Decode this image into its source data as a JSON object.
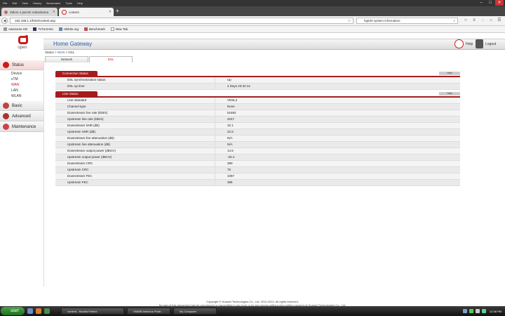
{
  "browser": {
    "menu": [
      "File",
      "Edit",
      "View",
      "History",
      "Bookmarks",
      "Tools",
      "Help"
    ],
    "tabs": [
      {
        "label": "Zakon o javnim nabavkama",
        "active": false
      },
      {
        "label": "content",
        "active": true
      }
    ],
    "url": "192.168.1.1/html/content.asp",
    "search_text": "hg630 system information",
    "bookmarks": [
      "Awesome HD",
      "TvTorrents",
      "HDbits.org",
      "Benchmark",
      "New Tab"
    ]
  },
  "app": {
    "logo_text": "open",
    "title": "Home Gateway",
    "help_label": "Help",
    "logout_label": "Logout",
    "breadcrumb": {
      "a": "Status",
      "sep": " > ",
      "b": "WAN",
      "c": "DSL"
    },
    "subtabs": [
      {
        "label": "Network",
        "active": false
      },
      {
        "label": "DSL",
        "active": true
      }
    ]
  },
  "sidebar": {
    "groups": [
      {
        "label": "Status",
        "active": true,
        "items": [
          {
            "label": "Device",
            "active": false
          },
          {
            "label": "xTM",
            "active": false
          },
          {
            "label": "WAN",
            "active": true
          },
          {
            "label": "LAN",
            "active": false
          },
          {
            "label": "WLAN",
            "active": false
          }
        ]
      },
      {
        "label": "Basic",
        "active": false,
        "items": []
      },
      {
        "label": "Advanced",
        "active": false,
        "items": []
      },
      {
        "label": "Maintenance",
        "active": false,
        "items": []
      }
    ]
  },
  "connection_status": {
    "title": "Connection Status",
    "help": "Help",
    "rows": [
      {
        "key": "DSL synchronization status",
        "value": "Up"
      },
      {
        "key": "DSL up time",
        "value": "2 Days 23:32:14"
      }
    ]
  },
  "line_status": {
    "title": "Line Status",
    "help": "Help",
    "rows": [
      {
        "key": "Line standard",
        "value": "VDSL2"
      },
      {
        "key": "Channel type",
        "value": "None"
      },
      {
        "key": "Downstream line rate (kbit/s)",
        "value": "51692"
      },
      {
        "key": "Upstream line rate (kbit/s)",
        "value": "2047"
      },
      {
        "key": "Downstream SNR (dB)",
        "value": "32.1"
      },
      {
        "key": "Upstream SNR (dB)",
        "value": "22.5"
      },
      {
        "key": "Downstream line attenuation (dB)",
        "value": "N/A"
      },
      {
        "key": "Upstream line attenuation (dB)",
        "value": "N/A"
      },
      {
        "key": "Downstream output power (dBmV)",
        "value": "14.5"
      },
      {
        "key": "Upstream output power (dBmV)",
        "value": "-25.4"
      },
      {
        "key": "Downstream CRC",
        "value": "390"
      },
      {
        "key": "Upstream CRC",
        "value": "75"
      },
      {
        "key": "Downstream FEC",
        "value": "1087"
      },
      {
        "key": "Upstream FEC",
        "value": "385"
      }
    ]
  },
  "footer": {
    "line1": "Copyright © Huawei Technologies Co., Ltd. 2012-2012. All rights reserved.",
    "line2": "No part of this document may be reproduced or transmitted in any form or by any means without prior written consent of Huawei Technologies Co., Ltd."
  },
  "taskbar": {
    "start_label": "start",
    "items": [
      "content - Mozilla Firefox",
      "VMWB Antivirus Prote...",
      "My Computer"
    ],
    "clock": "12:38 PM"
  },
  "colors": {
    "accent": "#a61c1c",
    "brand": "#cc1b1b",
    "title": "#2b5ea8"
  }
}
